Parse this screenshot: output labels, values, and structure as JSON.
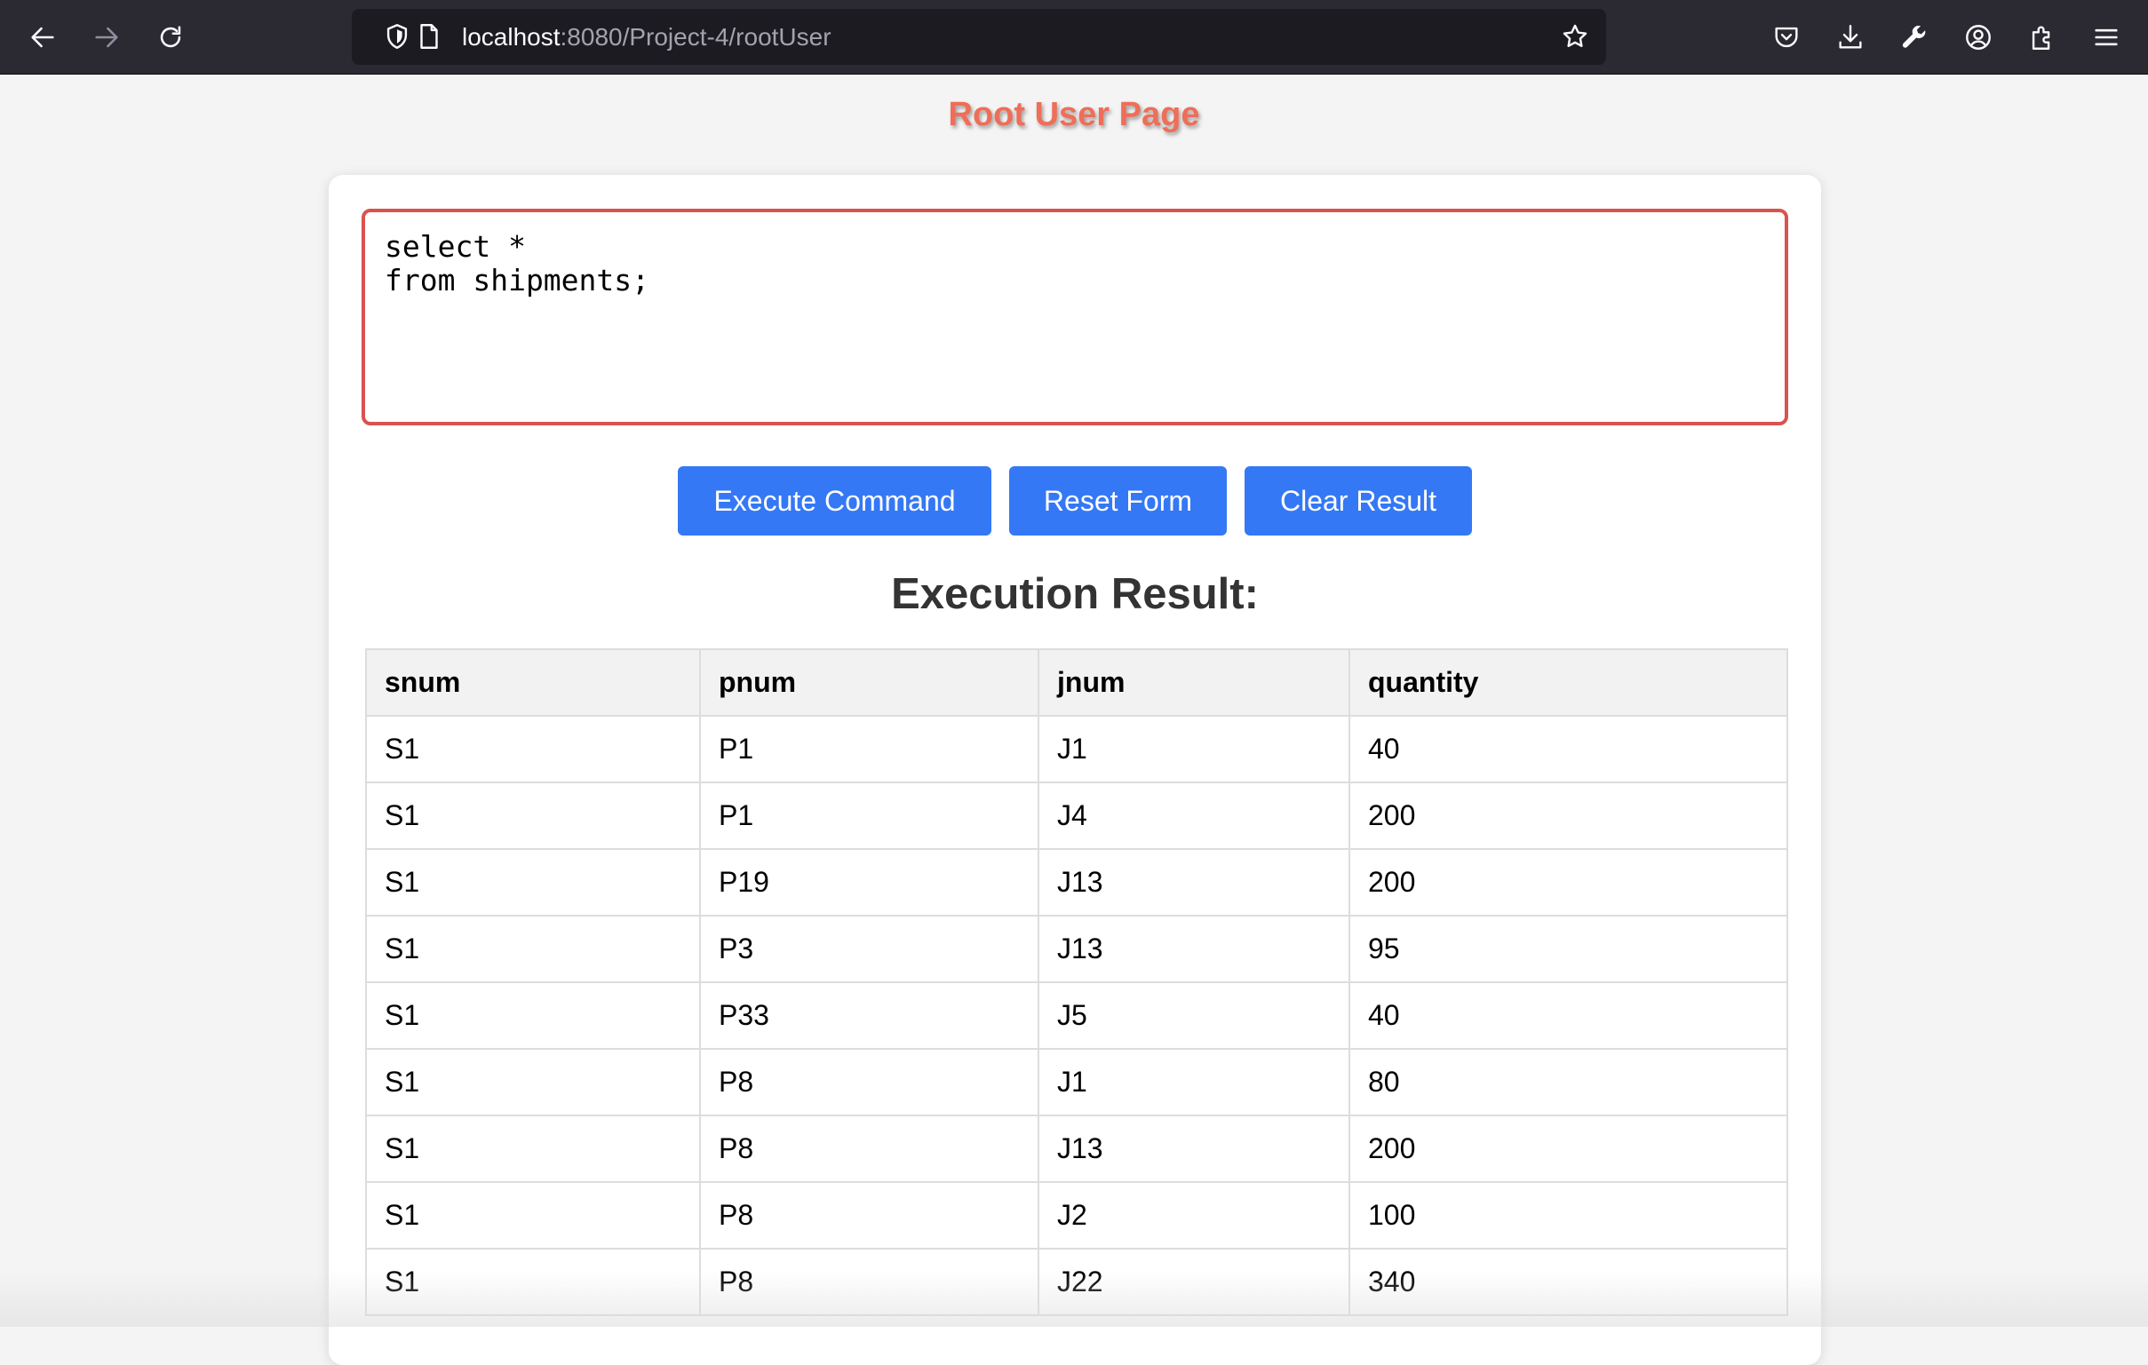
{
  "browser": {
    "url_host": "localhost",
    "url_path": ":8080/Project-4/rootUser",
    "icons": {
      "back": "arrow-left-icon",
      "forward": "arrow-right-icon",
      "reload": "reload-icon",
      "shield": "shield-icon",
      "page": "page-icon",
      "bookmark": "star-icon",
      "pocket": "pocket-icon",
      "downloads": "download-icon",
      "tools": "wrench-icon",
      "account": "account-icon",
      "extensions": "puzzle-icon",
      "menu": "hamburger-menu-icon"
    }
  },
  "page": {
    "title": "Root User Page",
    "title_color": "#ef6e58"
  },
  "command": {
    "text": "select *\nfrom shipments;",
    "border_color": "#d9534f"
  },
  "buttons": {
    "execute": "Execute Command",
    "reset": "Reset Form",
    "clear": "Clear Result",
    "color": "#3478f6"
  },
  "result": {
    "heading": "Execution Result:",
    "columns": [
      "snum",
      "pnum",
      "jnum",
      "quantity"
    ],
    "rows": [
      [
        "S1",
        "P1",
        "J1",
        "40"
      ],
      [
        "S1",
        "P1",
        "J4",
        "200"
      ],
      [
        "S1",
        "P19",
        "J13",
        "200"
      ],
      [
        "S1",
        "P3",
        "J13",
        "95"
      ],
      [
        "S1",
        "P33",
        "J5",
        "40"
      ],
      [
        "S1",
        "P8",
        "J1",
        "80"
      ],
      [
        "S1",
        "P8",
        "J13",
        "200"
      ],
      [
        "S1",
        "P8",
        "J2",
        "100"
      ],
      [
        "S1",
        "P8",
        "J22",
        "340"
      ]
    ]
  }
}
